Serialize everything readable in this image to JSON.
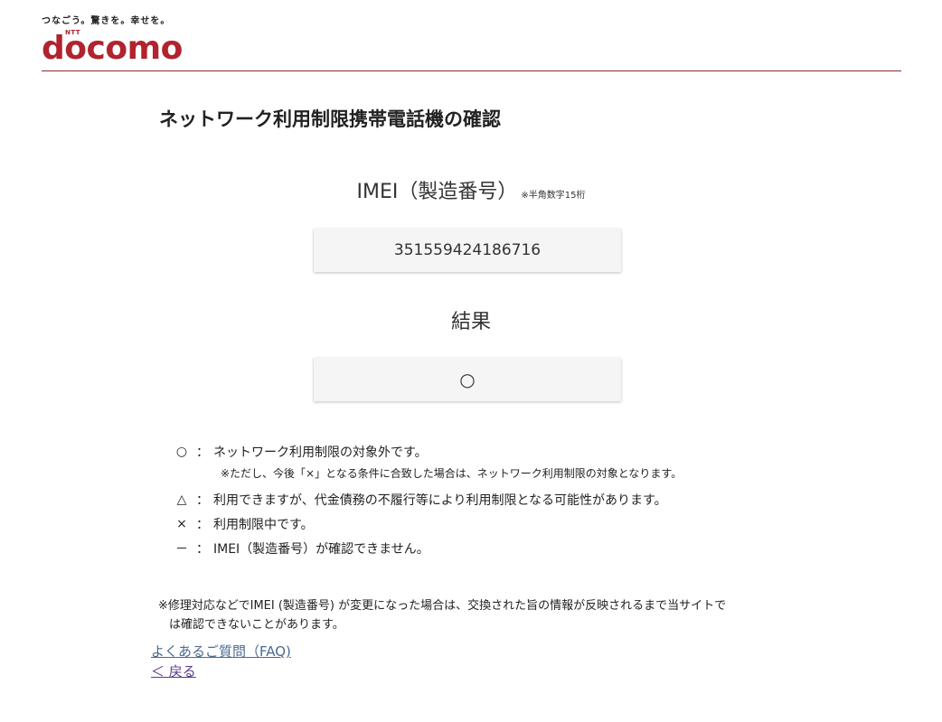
{
  "header": {
    "tagline": "つなごう。驚きを。幸せを。",
    "logo_text": "docomo",
    "logo_sup": "NTT",
    "accent_color": "#b0232f"
  },
  "page": {
    "title": "ネットワーク利用制限携帯電話機の確認"
  },
  "imei": {
    "label": "IMEI（製造番号）",
    "note": "※半角数字15桁",
    "value": "351559424186716"
  },
  "result": {
    "label": "結果",
    "value": "○"
  },
  "legend": [
    {
      "symbol": "○",
      "colon": "：",
      "text": "ネットワーク利用制限の対象外です。"
    },
    {
      "symbol": "△",
      "colon": "：",
      "text": "利用できますが、代金債務の不履行等により利用制限となる可能性があります。"
    },
    {
      "symbol": "×",
      "colon": "：",
      "text": "利用制限中です。"
    },
    {
      "symbol": "－",
      "colon": "：",
      "text": "IMEI（製造番号）が確認できません。"
    }
  ],
  "legend_note": "※ただし、今後「×」となる条件に合致した場合は、ネットワーク利用制限の対象となります。",
  "footnote": {
    "line1": "※修理対応などでIMEI (製造番号) が変更になった場合は、交換された旨の情報が反映されるまで当サイトで",
    "line2": "は確認できないことがあります。"
  },
  "links": {
    "faq": "よくあるご質問（FAQ)",
    "back": "＜ 戻る"
  }
}
